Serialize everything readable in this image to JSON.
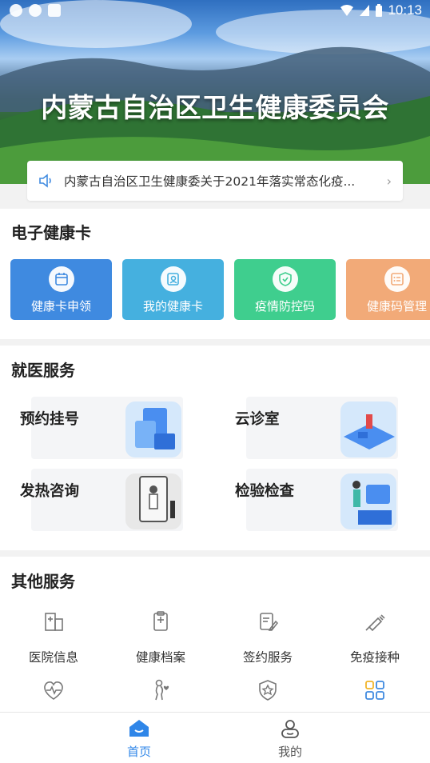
{
  "status_bar": {
    "time": "10:13"
  },
  "banner": {
    "title": "内蒙古自治区卫生健康委员会"
  },
  "notice": {
    "text": "内蒙古自治区卫生健康委关于2021年落实常态化疫..."
  },
  "health_card": {
    "title": "电子健康卡",
    "cards": [
      {
        "label": "健康卡申领",
        "icon": "calendar-icon",
        "color": "#3f8ae0"
      },
      {
        "label": "我的健康卡",
        "icon": "id-card-icon",
        "color": "#45b0df"
      },
      {
        "label": "疫情防控码",
        "icon": "shield-icon",
        "color": "#3fce8e"
      },
      {
        "label": "健康码管理",
        "icon": "checklist-icon",
        "color": "#f2aa78"
      }
    ]
  },
  "medical": {
    "title": "就医服务",
    "items": [
      {
        "label": "预约挂号"
      },
      {
        "label": "云诊室"
      },
      {
        "label": "发热咨询"
      },
      {
        "label": "检验检查"
      }
    ]
  },
  "other": {
    "title": "其他服务",
    "items": [
      {
        "label": "医院信息",
        "icon": "hospital-building-icon"
      },
      {
        "label": "健康档案",
        "icon": "medical-record-icon"
      },
      {
        "label": "签约服务",
        "icon": "contract-edit-icon"
      },
      {
        "label": "免疫接种",
        "icon": "syringe-icon"
      },
      {
        "icon": "heartbeat-icon"
      },
      {
        "icon": "maternal-icon"
      },
      {
        "icon": "star-shield-icon"
      },
      {
        "icon": "more-grid-icon"
      }
    ]
  },
  "tabbar": {
    "home": "首页",
    "mine": "我的",
    "active_color": "#2f86e8",
    "inactive_color": "#555555"
  }
}
